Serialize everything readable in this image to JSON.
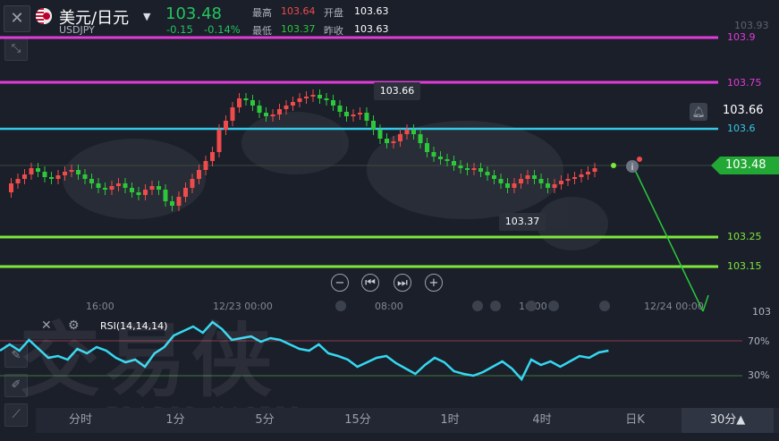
{
  "header": {
    "pair_name": "美元/日元",
    "pair_code": "USDJPY",
    "last_price": "103.48",
    "change": "-0.15",
    "change_pct": "-0.14%",
    "stats": {
      "high_label": "最高",
      "high_value": "103.64",
      "open_label": "开盘",
      "open_value": "103.63",
      "low_label": "最低",
      "low_value": "103.37",
      "prev_close_label": "昨收",
      "prev_close_value": "103.63"
    }
  },
  "axis_labels": [
    "103.93",
    "103.9",
    "103.75",
    "103.66",
    "103.6",
    "103.48",
    "103.25",
    "103.15",
    "103"
  ],
  "levels": [
    {
      "label": "103.9",
      "color": "#e23bd9"
    },
    {
      "label": "103.75",
      "color": "#e23bd9"
    },
    {
      "label": "103.6",
      "color": "#35c8e8"
    },
    {
      "label": "103.25",
      "color": "#7ee83a"
    },
    {
      "label": "103.15",
      "color": "#7ee83a"
    }
  ],
  "tooltips": {
    "high": "103.66",
    "low": "103.37"
  },
  "time_labels": [
    "16:00",
    "12/23 00:00",
    "08:00",
    "16:00",
    "12/24 00:00"
  ],
  "rsi": {
    "label": "RSI(14,14,14)",
    "upper": "70%",
    "lower": "30%"
  },
  "timeframes": [
    "分时",
    "1分",
    "5分",
    "15分",
    "1时",
    "4时",
    "日K",
    "30分▲"
  ],
  "watermark": {
    "cn": "交易侠",
    "en": "TRADER MASTER"
  },
  "colors": {
    "up": "#ef4b4b",
    "down": "#2cc83a",
    "accent": "#22c55e"
  }
}
